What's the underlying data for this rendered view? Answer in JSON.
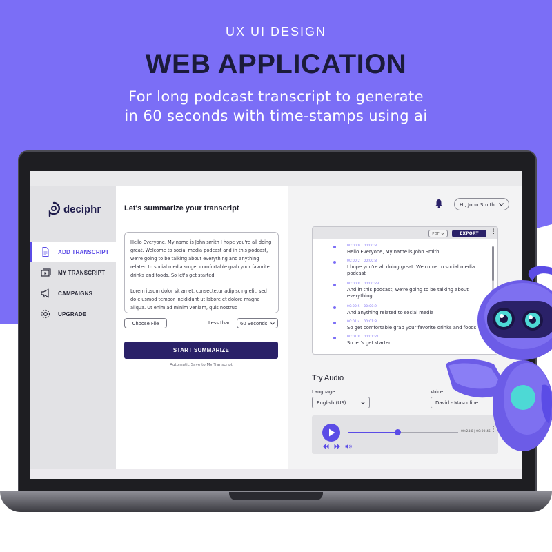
{
  "hero": {
    "kicker": "UX UI DESIGN",
    "headline": "WEB APPLICATION",
    "subline_1": "For long podcast transcript to generate",
    "subline_2": "in 60 seconds with time-stamps using ai"
  },
  "brand": {
    "name": "deciphr",
    "accent": "#5b4ce6",
    "dark": "#2a2168",
    "background": "#7b6ef6"
  },
  "sidebar": {
    "items": [
      {
        "label": "ADD TRANSCRIPT",
        "icon": "document-icon",
        "active": true
      },
      {
        "label": "MY TRANSCRIPT",
        "icon": "video-stack-icon",
        "active": false
      },
      {
        "label": "CAMPAIGNS",
        "icon": "megaphone-icon",
        "active": false
      },
      {
        "label": "UPGRADE",
        "icon": "gear-icon",
        "active": false
      }
    ]
  },
  "summarize": {
    "title": "Let's summarize your transcript",
    "paragraph_1": "Hello Everyone, My name is John smith I hope you're all doing great. Welcome to social media podcast and in this podcast, we're going to be talking about everything and anything related to social media so get comfortable grab your favorite drinks and foods. So let's get started.",
    "paragraph_2": "Lorem ipsum dolor sit amet, consectetur adipiscing elit, sed do eiusmod tempor incididunt ut labore et dolore magna aliqua. Ut enim ad minim veniam, quis nostrud",
    "choose_file": "Choose File",
    "less_than": "Less than",
    "duration": "60 Seconds",
    "start_button": "START SUMMARIZE",
    "autosave_note": "Automatic Save to My Transcript"
  },
  "header": {
    "user_label": "Hi, John Smith"
  },
  "transcript": {
    "format": "PDF",
    "export_label": "EXPORT",
    "entries": [
      {
        "timestamp": "00:00:0 | 00:00:8",
        "text": "Hello Everyone, My name is John Smith"
      },
      {
        "timestamp": "00:00:2 | 00:00:8",
        "text": "I hope you're all doing great. Welcome to social media podcast"
      },
      {
        "timestamp": "00:00:8 | 00:00:23",
        "text": "And in this podcast, we're going to be talking about everything"
      },
      {
        "timestamp": "00:00:5 | 00:00:9",
        "text": "And anything related to social media"
      },
      {
        "timestamp": "00:01:4 | 00:01:8",
        "text": "So get comfortable grab your favorite drinks and foods"
      },
      {
        "timestamp": "00:01:8 | 00:01:21",
        "text": "So let's get started"
      }
    ]
  },
  "audio": {
    "title": "Try Audio",
    "language_label": "Language",
    "language_value": "English (US)",
    "voice_label": "Voice",
    "voice_value": "David - Masculine",
    "time": "00:24:8 | 00:00:45",
    "progress": 0.45
  }
}
